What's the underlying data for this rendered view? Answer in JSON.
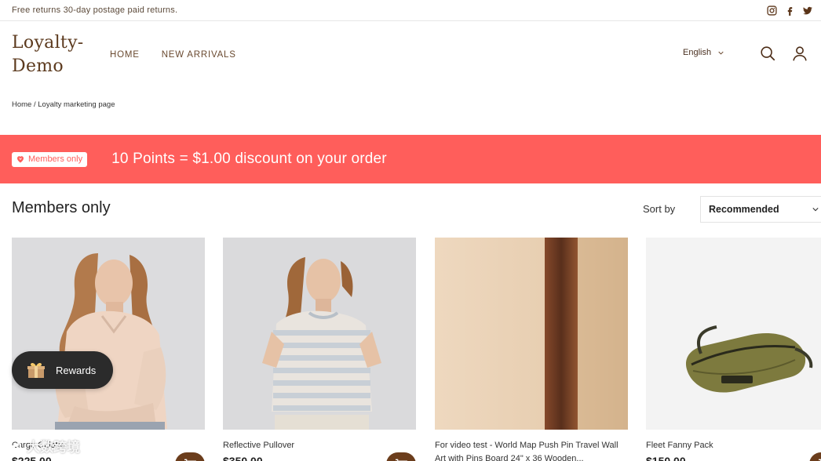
{
  "topbar": {
    "announcement": "Free returns 30-day postage paid returns.",
    "social": [
      "instagram-icon",
      "facebook-icon",
      "twitter-icon"
    ]
  },
  "header": {
    "logo_line1": "Loyalty-",
    "logo_line2": "Demo",
    "nav": [
      "HOME",
      "NEW ARRIVALS"
    ],
    "language": "English"
  },
  "breadcrumb": {
    "home": "Home",
    "separator": " / ",
    "current": "Loyalty marketing page"
  },
  "banner": {
    "badge": "Members only",
    "headline": "10 Points = $1.00 discount on your order",
    "color": "#ff5e5b"
  },
  "section": {
    "title": "Members only",
    "sort_label": "Sort by",
    "sort_value": "Recommended"
  },
  "products": [
    {
      "name": "Cargo Culotte",
      "price": "$225.00"
    },
    {
      "name": "Reflective Pullover",
      "price": "$350.00"
    },
    {
      "name": "For video test - World Map Push Pin Travel Wall Art with Pins Board 24\" x 36 Wooden...",
      "price": ""
    },
    {
      "name": "Fleet Fanny Pack",
      "price": "$150.00"
    }
  ],
  "rewards": {
    "label": "Rewards"
  },
  "watermark": {
    "text": "大数跨境"
  },
  "colors": {
    "brand": "#6b3d1c",
    "accent": "#ff5e5b"
  }
}
